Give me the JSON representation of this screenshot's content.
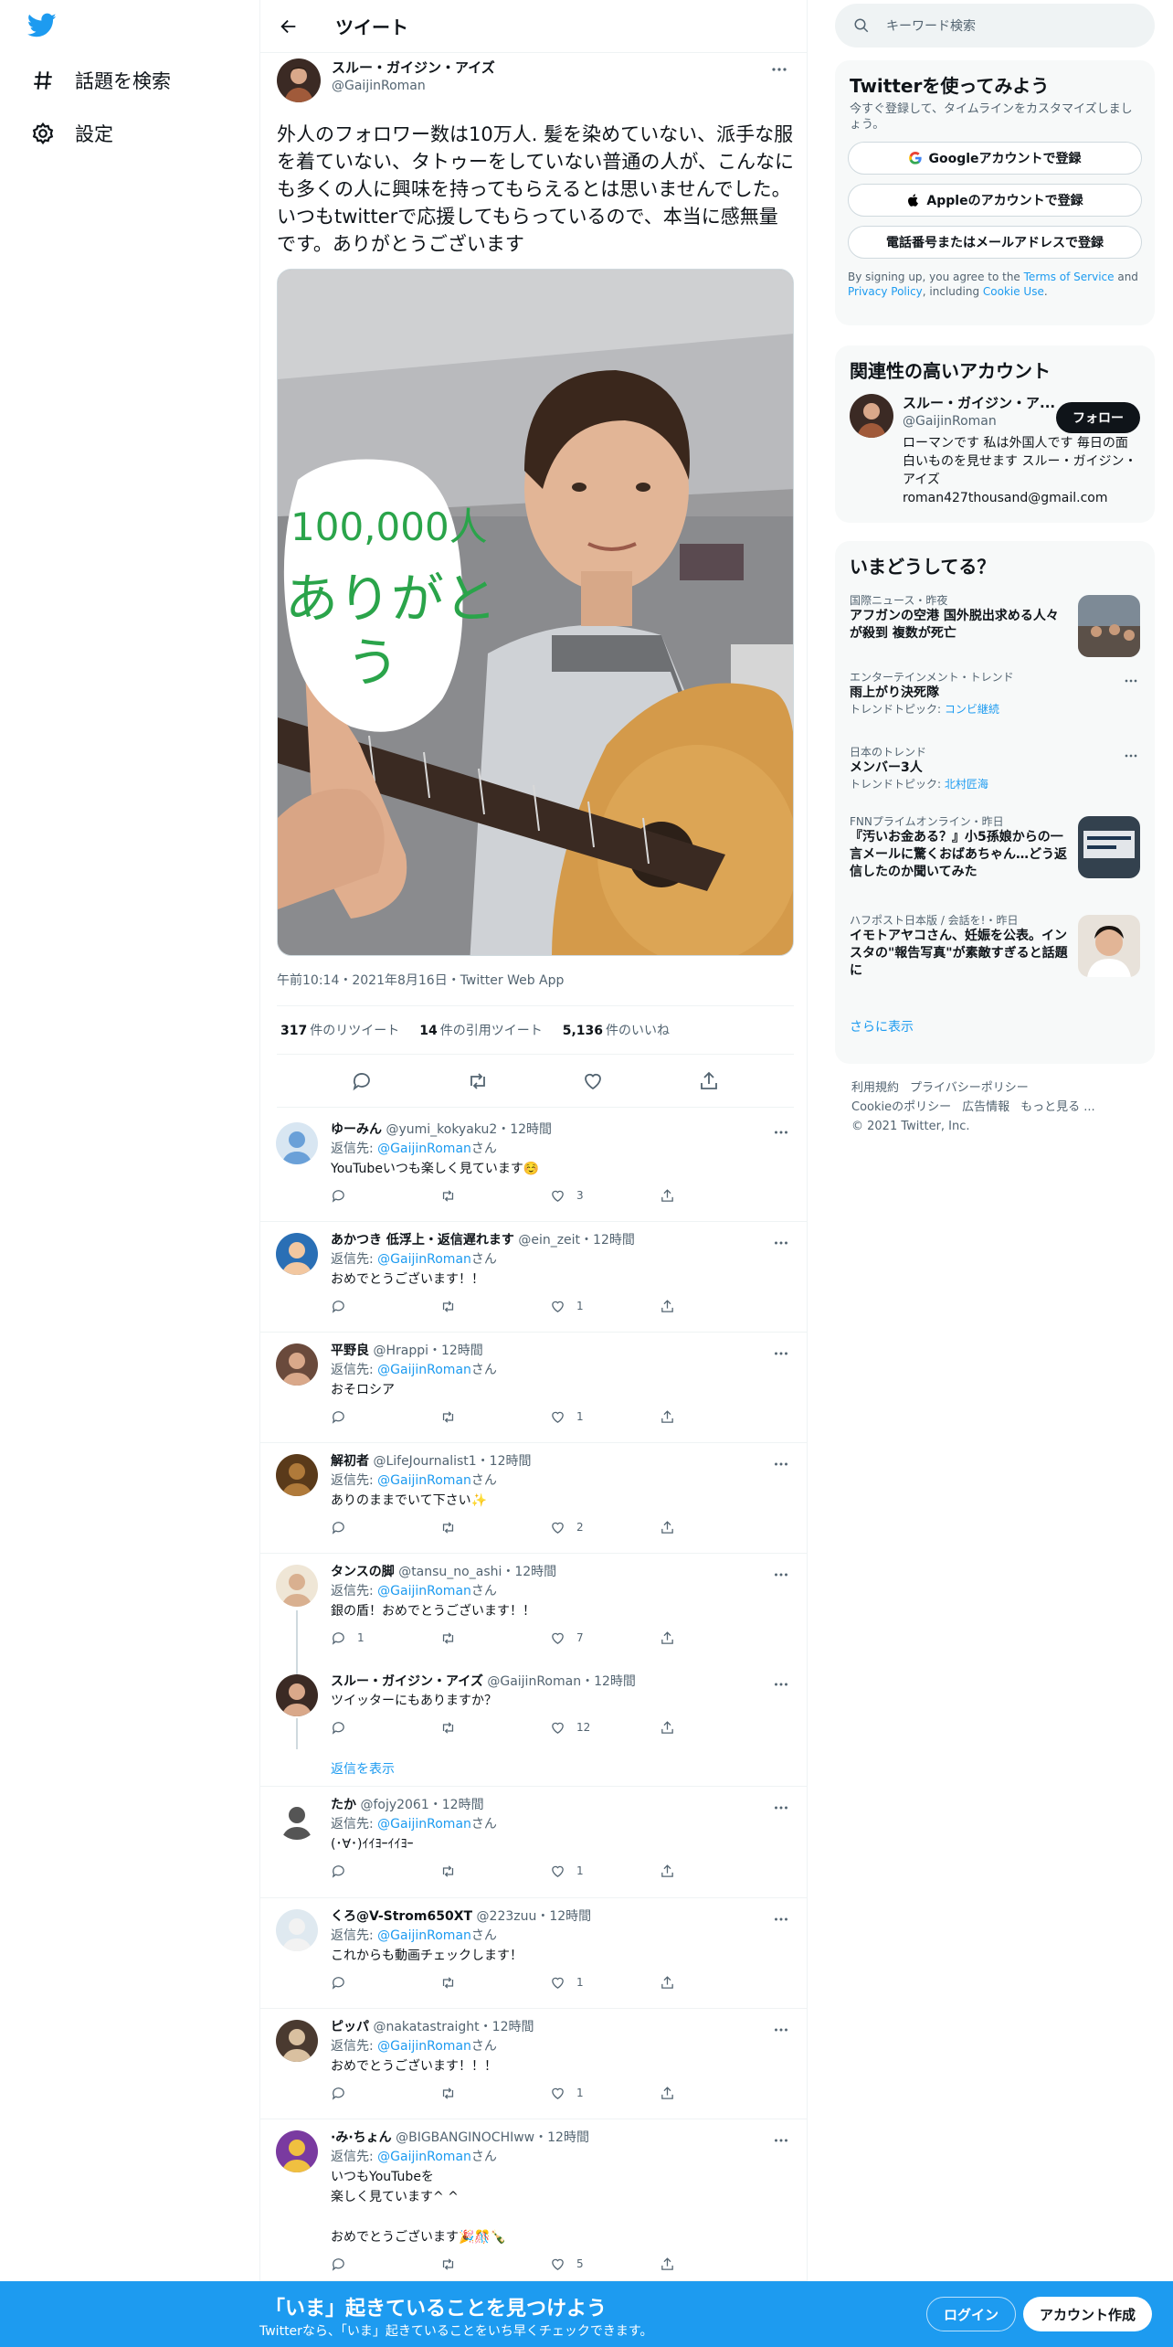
{
  "nav": {
    "explore_label": "話題を検索",
    "settings_label": "設定"
  },
  "header": {
    "title": "ツイート"
  },
  "tweet": {
    "name": "スルー・ガイジン・アイズ",
    "handle": "@GaijinRoman",
    "text": "外人のフォロワー数は10万人. 髪を染めていない、派手な服を着ていない、タトゥーをしていない普通の人が、こんなにも多くの人に興味を持ってもらえるとは思いませんでした。いつもtwitterで応援してもらっているので、本当に感無量です。ありがとうございます",
    "sign_line1": "100,000人",
    "sign_line2": "ありがと",
    "sign_line3": "う",
    "meta": "午前10:14・2021年8月16日・Twitter Web App",
    "retweets": "317",
    "retweets_label": "件のリツイート",
    "quotes": "14",
    "quotes_label": "件の引用ツイート",
    "likes": "5,136",
    "likes_label": "件のいいね"
  },
  "replies": [
    {
      "name": "ゆーみん",
      "handle": "@yumi_kokyaku2・12時間",
      "reply_prefix": "返信先: ",
      "reply_to": "@GaijinRoman",
      "reply_suffix": "さん",
      "text": "YouTubeいつも楽しく見ています☺️",
      "replies": "",
      "likes": "3"
    },
    {
      "name": "あかつき 低浮上・返信遅れます",
      "handle": "@ein_zeit・12時間",
      "reply_prefix": "返信先: ",
      "reply_to": "@GaijinRoman",
      "reply_suffix": "さん",
      "text": "おめでとうございます！！",
      "replies": "",
      "likes": "1"
    },
    {
      "name": "平野良",
      "handle": "@Hrappi・12時間",
      "reply_prefix": "返信先: ",
      "reply_to": "@GaijinRoman",
      "reply_suffix": "さん",
      "text": "おそロシア",
      "replies": "",
      "likes": "1"
    },
    {
      "name": "解初者",
      "handle": "@LifeJournalist1・12時間",
      "reply_prefix": "返信先: ",
      "reply_to": "@GaijinRoman",
      "reply_suffix": "さん",
      "text": "ありのままでいて下さい✨",
      "replies": "",
      "likes": "2"
    },
    {
      "name": "タンスの脚",
      "handle": "@tansu_no_ashi・12時間",
      "reply_prefix": "返信先: ",
      "reply_to": "@GaijinRoman",
      "reply_suffix": "さん",
      "text": "銀の盾！おめでとうございます！！",
      "replies": "1",
      "likes": "7"
    },
    {
      "name": "スルー・ガイジン・アイズ",
      "handle": "@GaijinRoman・12時間",
      "reply_prefix": "",
      "reply_to": "",
      "reply_suffix": "",
      "text": "ツイッターにもありますか？",
      "replies": "",
      "likes": "12",
      "show_replies": "返信を表示"
    },
    {
      "name": "たか",
      "handle": "@fojy2061・12時間",
      "reply_prefix": "返信先: ",
      "reply_to": "@GaijinRoman",
      "reply_suffix": "さん",
      "text": "(･∀･)ｲｲﾖｰｲｲﾖｰ",
      "replies": "",
      "likes": "1"
    },
    {
      "name": "くろ@V-Strom650XT",
      "handle": "@223zuu・12時間",
      "reply_prefix": "返信先: ",
      "reply_to": "@GaijinRoman",
      "reply_suffix": "さん",
      "text": "これからも動画チェックします！",
      "replies": "",
      "likes": "1"
    },
    {
      "name": "ピッパ",
      "handle": "@nakatastraight・12時間",
      "reply_prefix": "返信先: ",
      "reply_to": "@GaijinRoman",
      "reply_suffix": "さん",
      "text": "おめでとうございます！！！",
      "replies": "",
      "likes": "1"
    },
    {
      "name": "·み·ちょん",
      "handle": "@BIGBANGINOCHIww・12時間",
      "reply_prefix": "返信先: ",
      "reply_to": "@GaijinRoman",
      "reply_suffix": "さん",
      "text": "いつもYouTubeを\n楽しく見ています^ ^\n\nおめでとうございます🎉🎊🍾",
      "replies": "",
      "likes": "5"
    }
  ],
  "search": {
    "placeholder": "キーワード検索"
  },
  "signup": {
    "title": "Twitterを使ってみよう",
    "sub": "今すぐ登録して、タイムラインをカスタマイズしましょう。",
    "google": "Googleアカウントで登録",
    "apple": "Appleのアカウントで登録",
    "phone": "電話番号またはメールアドレスで登録",
    "terms_1": "By signing up, you agree to the ",
    "terms_link1": "Terms of Service",
    "terms_2": " and ",
    "terms_link2": "Privacy Policy",
    "terms_3": ", including ",
    "terms_link3": "Cookie Use",
    "terms_4": "."
  },
  "related": {
    "title": "関連性の高いアカウント",
    "name": "スルー・ガイジン・ア...",
    "handle": "@GaijinRoman",
    "follow": "フォロー",
    "bio": "ローマンです 私は外国人です 毎日の面白いものを見せます スルー・ガイジン・アイズ roman427thousand@gmail.com"
  },
  "trends": {
    "title": "いまどうしてる？",
    "items": [
      {
        "category": "国際ニュース・昨夜",
        "title": "アフガンの空港 国外脱出求める人々が殺到 複数が死亡",
        "sub_prefix": "",
        "sub_link": ""
      },
      {
        "category": "エンターテインメント・トレンド",
        "title": "雨上がり決死隊",
        "sub_prefix": "トレンドトピック: ",
        "sub_link": "コンビ継続"
      },
      {
        "category": "日本のトレンド",
        "title": "メンバー3人",
        "sub_prefix": "トレンドトピック: ",
        "sub_link": "北村匠海"
      },
      {
        "category": "FNNプライムオンライン・昨日",
        "title": "『汚いお金ある？』小5孫娘からの一言メールに驚くおばあちゃん…どう返信したのか聞いてみた",
        "sub_prefix": "",
        "sub_link": ""
      },
      {
        "category": "ハフポスト日本版 / 会話を!・昨日",
        "title": "イモトアヤコさん、妊娠を公表。インスタの\"報告写真\"が素敵すぎると話題に",
        "sub_prefix": "",
        "sub_link": ""
      }
    ],
    "show_more": "さらに表示"
  },
  "footer": {
    "terms": "利用規約",
    "privacy": "プライバシーポリシー",
    "cookie": "Cookieのポリシー",
    "ads": "広告情報",
    "more": "もっと見る ...",
    "copyright": "© 2021 Twitter, Inc."
  },
  "bottom": {
    "title": "「いま」起きていることを見つけよう",
    "sub": "Twitterなら、「いま」起きていることをいち早くチェックできます。",
    "login": "ログイン",
    "signup": "アカウント作成"
  },
  "colors": {
    "accent": "#1d9bf0",
    "text": "#0f1419",
    "secondary": "#536471"
  }
}
